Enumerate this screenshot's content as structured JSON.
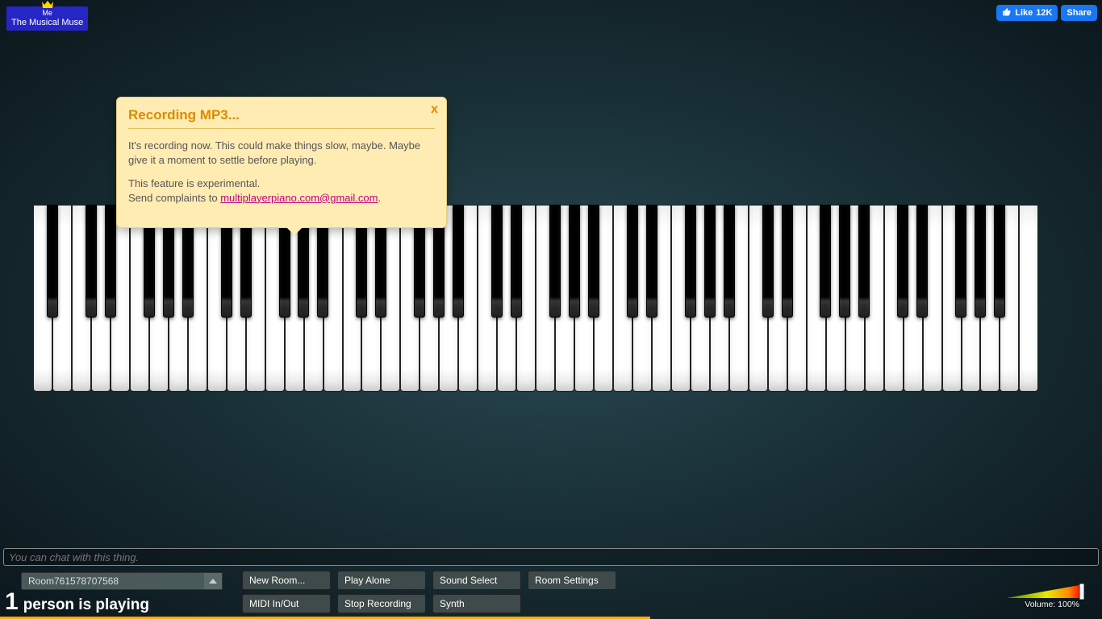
{
  "user": {
    "me_label": "Me",
    "name": "The Musical Muse"
  },
  "fb": {
    "like_label": "Like",
    "like_count": "12K",
    "share_label": "Share"
  },
  "notification": {
    "title": "Recording MP3...",
    "close": "x",
    "body1": "It's recording now. This could make things slow, maybe. Maybe give it a moment to settle before playing.",
    "body2a": "This feature is experimental.",
    "body2b": "Send complaints to ",
    "email": "multiplayerpiano.com@gmail.com",
    "body2c": "."
  },
  "chat": {
    "placeholder": "You can chat with this thing."
  },
  "room": {
    "current": "Room761578707568"
  },
  "status": {
    "count": "1",
    "text": "person is playing"
  },
  "buttons": {
    "new_room": "New Room...",
    "play_alone": "Play Alone",
    "sound_select": "Sound Select",
    "room_settings": "Room Settings",
    "midi": "MIDI In/Out",
    "stop_recording": "Stop Recording",
    "synth": "Synth"
  },
  "volume": {
    "label_prefix": "Volume: ",
    "value": "100%",
    "percent": 100
  },
  "progress": {
    "percent": 59
  },
  "piano": {
    "white_key_count": 52
  }
}
